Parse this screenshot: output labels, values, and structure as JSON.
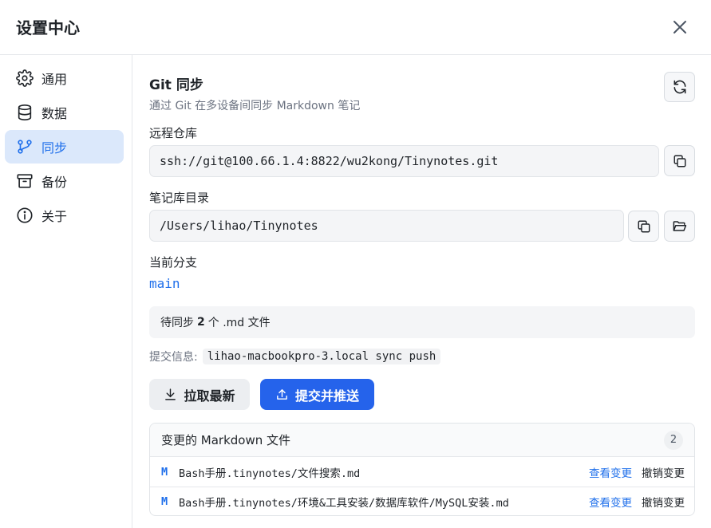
{
  "dialog": {
    "title": "设置中心"
  },
  "sidebar": {
    "items": [
      {
        "label": "通用",
        "icon": "gear-icon"
      },
      {
        "label": "数据",
        "icon": "database-icon"
      },
      {
        "label": "同步",
        "icon": "git-branch-icon",
        "active": true
      },
      {
        "label": "备份",
        "icon": "archive-icon"
      },
      {
        "label": "关于",
        "icon": "info-icon"
      }
    ]
  },
  "sync": {
    "title": "Git 同步",
    "description": "通过 Git 在多设备间同步 Markdown 笔记",
    "remote_label": "远程仓库",
    "remote_value": "ssh://git@100.66.1.4:8822/wu2kong/Tinynotes.git",
    "dir_label": "笔记库目录",
    "dir_value": "/Users/lihao/Tinynotes",
    "branch_label": "当前分支",
    "branch_value": "main",
    "pending_prefix": "待同步",
    "pending_count": "2",
    "pending_suffix": "个 .md 文件",
    "commit_label": "提交信息:",
    "commit_value": "lihao-macbookpro-3.local sync push",
    "pull_label": "拉取最新",
    "push_label": "提交并推送"
  },
  "changes": {
    "title": "变更的 Markdown 文件",
    "count": "2",
    "view_label": "查看变更",
    "revert_label": "撤销变更",
    "files": [
      {
        "status": "M",
        "path": "Bash手册.tinynotes/文件搜索.md"
      },
      {
        "status": "M",
        "path": "Bash手册.tinynotes/环境&工具安装/数据库软件/MySQL安装.md"
      }
    ]
  },
  "colors": {
    "accent": "#2563eb",
    "link": "#1f6feb",
    "active_bg": "#dbe8fb"
  }
}
